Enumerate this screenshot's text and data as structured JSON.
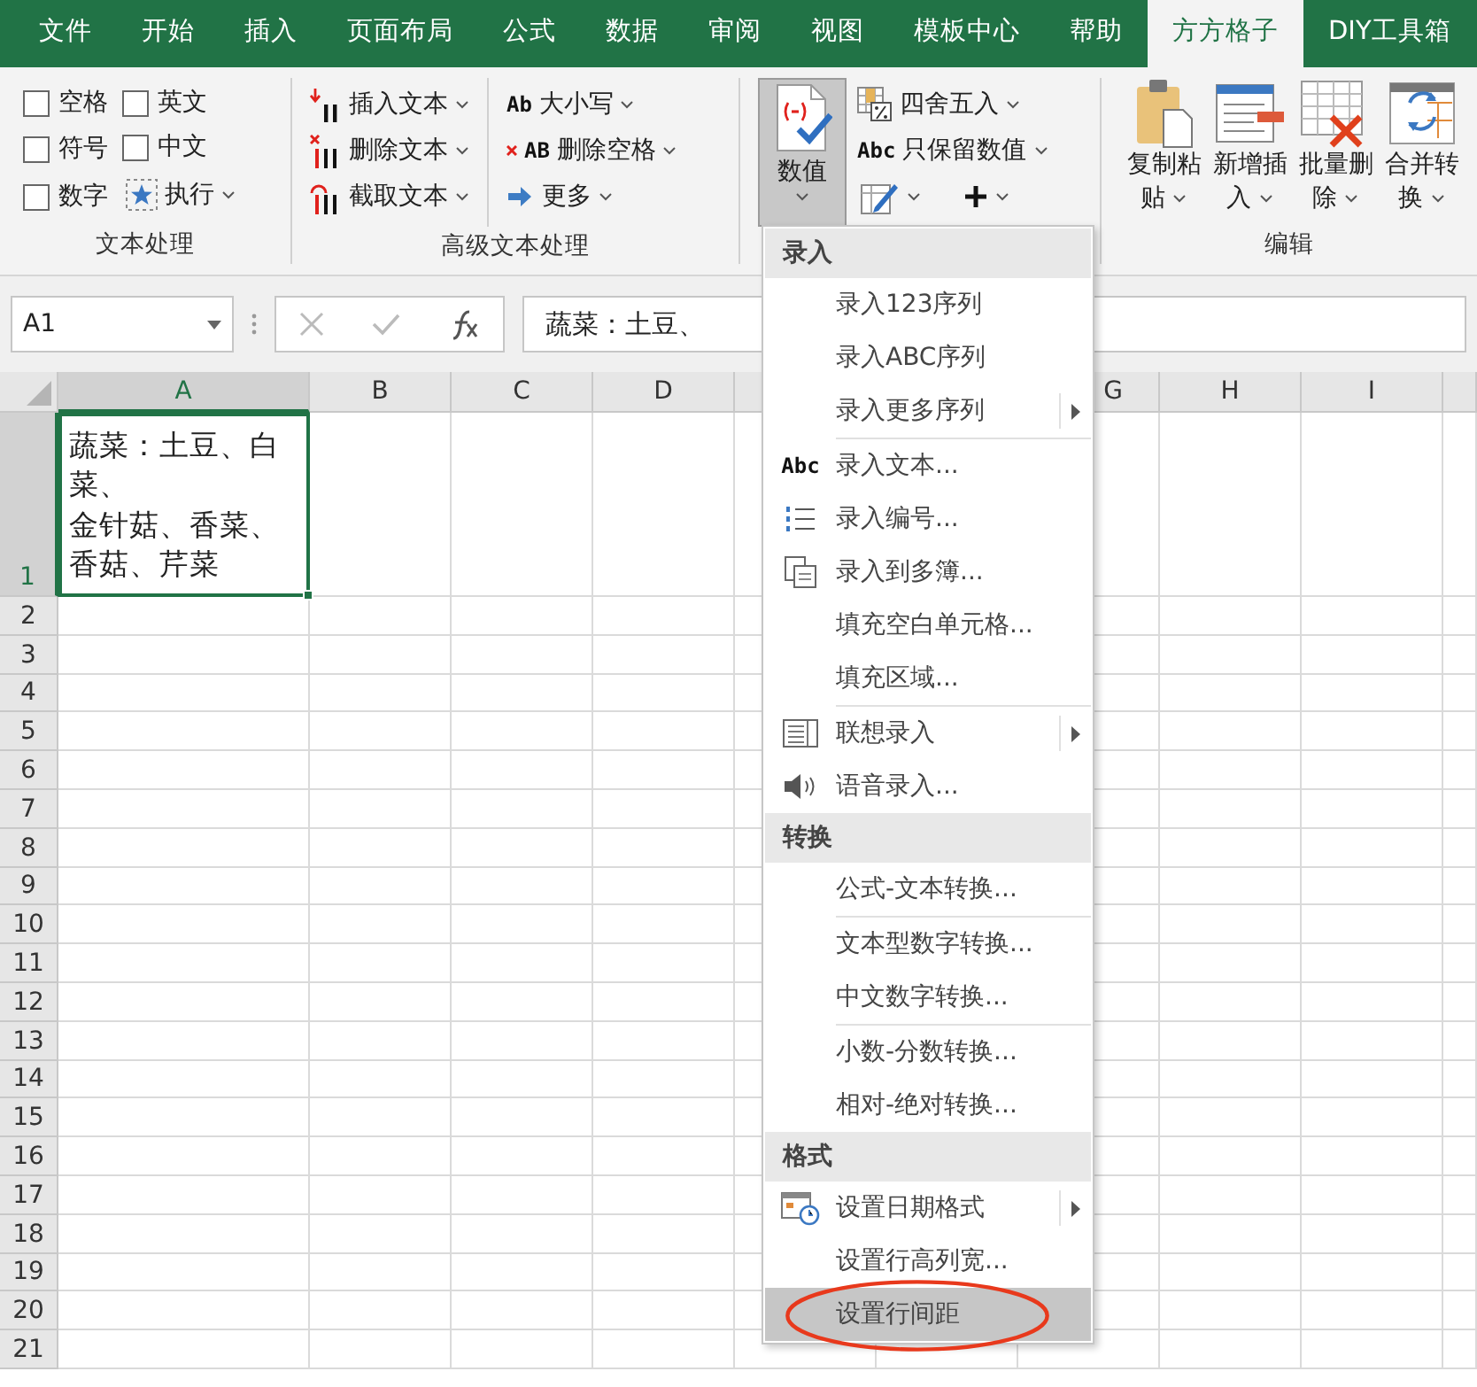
{
  "tabs": [
    {
      "label": "文件",
      "selected": false
    },
    {
      "label": "开始",
      "selected": false
    },
    {
      "label": "插入",
      "selected": false
    },
    {
      "label": "页面布局",
      "selected": false
    },
    {
      "label": "公式",
      "selected": false
    },
    {
      "label": "数据",
      "selected": false
    },
    {
      "label": "审阅",
      "selected": false
    },
    {
      "label": "视图",
      "selected": false
    },
    {
      "label": "模板中心",
      "selected": false
    },
    {
      "label": "帮助",
      "selected": false
    },
    {
      "label": "方方格子",
      "selected": true
    },
    {
      "label": "DIY工具箱",
      "selected": false
    }
  ],
  "text_group": {
    "label": "文本处理",
    "checkboxes": [
      {
        "label": "空格",
        "checked": false
      },
      {
        "label": "英文",
        "checked": false
      },
      {
        "label": "符号",
        "checked": false
      },
      {
        "label": "中文",
        "checked": false
      },
      {
        "label": "数字",
        "checked": false
      }
    ],
    "run_button": {
      "label": "执行"
    }
  },
  "advanced_group": {
    "label": "高级文本处理",
    "buttons": [
      {
        "label": "插入文本"
      },
      {
        "label": "删除文本"
      },
      {
        "label": "截取文本"
      },
      {
        "glyph": "Ab",
        "label": "大小写"
      },
      {
        "glyph": "AB",
        "label": "删除空格"
      },
      {
        "label": "更多"
      }
    ]
  },
  "number_group": {
    "main_button": {
      "label": "数值",
      "pressed": true
    },
    "buttons": [
      {
        "kind": "labeled",
        "label": "四舍五入"
      },
      {
        "kind": "labeled",
        "glyph": "Abc",
        "label": "只保留数值"
      },
      {
        "kind": "icon-only"
      },
      {
        "kind": "icon-only"
      }
    ]
  },
  "edit_group": {
    "label": "编辑",
    "buttons": [
      {
        "label": "复制粘贴"
      },
      {
        "label": "新增插入"
      },
      {
        "label": "批量删除"
      },
      {
        "label": "合并转换"
      }
    ]
  },
  "formula_bar": {
    "name_box": "A1",
    "formula": "蔬菜：土豆、"
  },
  "sheet": {
    "columns": [
      {
        "label": "A",
        "selected": true
      },
      {
        "label": "B",
        "selected": false
      },
      {
        "label": "C",
        "selected": false
      },
      {
        "label": "D",
        "selected": false
      },
      {},
      {},
      {
        "label": "G",
        "selected": false
      },
      {
        "label": "H",
        "selected": false
      },
      {
        "label": "I",
        "selected": false
      }
    ],
    "rows": [
      {
        "label": "1",
        "selected": true,
        "lines": [
          "蔬菜：土豆、白菜、",
          "金针菇、香菜、香菇、芹菜"
        ]
      },
      {
        "label": "2",
        "selected": false
      },
      {
        "label": "3",
        "selected": false
      },
      {
        "label": "4",
        "selected": false
      },
      {
        "label": "5",
        "selected": false
      },
      {
        "label": "6",
        "selected": false
      },
      {
        "label": "7",
        "selected": false
      },
      {
        "label": "8",
        "selected": false
      },
      {
        "label": "9",
        "selected": false
      },
      {
        "label": "10",
        "selected": false
      },
      {
        "label": "11",
        "selected": false
      },
      {
        "label": "12",
        "selected": false
      },
      {
        "label": "13",
        "selected": false
      },
      {
        "label": "14",
        "selected": false
      },
      {
        "label": "15",
        "selected": false
      },
      {
        "label": "16",
        "selected": false
      },
      {
        "label": "17",
        "selected": false
      },
      {
        "label": "18",
        "selected": false
      },
      {
        "label": "19",
        "selected": false
      },
      {
        "label": "20",
        "selected": false
      },
      {
        "label": "21",
        "selected": false
      }
    ]
  },
  "menu": {
    "items": [
      {
        "kind": "header",
        "label": "录入"
      },
      {
        "kind": "item",
        "label": "录入123序列",
        "submenu": false,
        "highlighted": false
      },
      {
        "kind": "item",
        "label": "录入ABC序列",
        "submenu": false,
        "highlighted": false
      },
      {
        "kind": "item",
        "label": "录入更多序列",
        "submenu": true,
        "highlighted": false
      },
      {
        "kind": "separator"
      },
      {
        "kind": "item",
        "glyph": "Abc",
        "label": "录入文本...",
        "submenu": false,
        "highlighted": false
      },
      {
        "kind": "item",
        "label": "录入编号...",
        "submenu": false,
        "highlighted": false
      },
      {
        "kind": "item",
        "label": "录入到多簿...",
        "submenu": false,
        "highlighted": false
      },
      {
        "kind": "item",
        "label": "填充空白单元格...",
        "submenu": false,
        "highlighted": false
      },
      {
        "kind": "item",
        "label": "填充区域...",
        "submenu": false,
        "highlighted": false
      },
      {
        "kind": "separator"
      },
      {
        "kind": "item",
        "label": "联想录入",
        "submenu": true,
        "highlighted": false
      },
      {
        "kind": "item",
        "label": "语音录入...",
        "submenu": false,
        "highlighted": false
      },
      {
        "kind": "header",
        "label": "转换"
      },
      {
        "kind": "item",
        "label": "公式-文本转换...",
        "submenu": false,
        "highlighted": false
      },
      {
        "kind": "separator"
      },
      {
        "kind": "item",
        "label": "文本型数字转换...",
        "submenu": false,
        "highlighted": false
      },
      {
        "kind": "item",
        "label": "中文数字转换...",
        "submenu": false,
        "highlighted": false
      },
      {
        "kind": "separator"
      },
      {
        "kind": "item",
        "label": "小数-分数转换...",
        "submenu": false,
        "highlighted": false
      },
      {
        "kind": "item",
        "label": "相对-绝对转换...",
        "submenu": false,
        "highlighted": false
      },
      {
        "kind": "header",
        "label": "格式"
      },
      {
        "kind": "item",
        "label": "设置日期格式",
        "submenu": true,
        "highlighted": false
      },
      {
        "kind": "item",
        "label": "设置行高列宽...",
        "submenu": false,
        "highlighted": false
      },
      {
        "kind": "item",
        "label": "设置行间距",
        "submenu": false,
        "highlighted": true,
        "circled": true
      }
    ]
  }
}
